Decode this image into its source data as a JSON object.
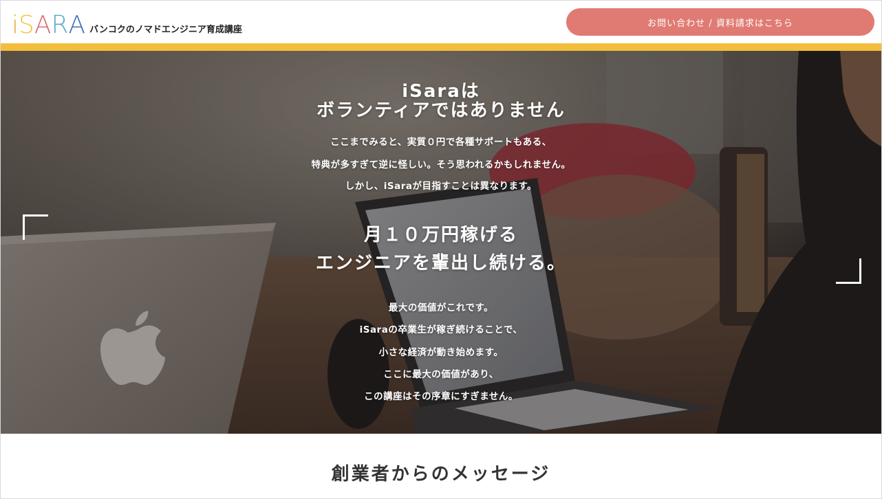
{
  "header": {
    "logo_letters": [
      "i",
      "S",
      "A",
      "R",
      "A"
    ],
    "logo_colors": [
      "#f2a93b",
      "#f3c23e",
      "#e06a6a",
      "#5aa8c8",
      "#3f72b8"
    ],
    "tagline": "バンコクのノマドエンジニア育成講座",
    "contact_button": "お問い合わせ / 資料請求はこちら",
    "contact_color": "#e07b73",
    "accent_color": "#f3bd3c"
  },
  "hero": {
    "title_line1": "iSaraは",
    "title_line2": "ボランティアではありません",
    "intro": [
      "ここまでみると、実質０円で各種サポートもある、",
      "特典が多すぎて逆に怪しい。そう思われるかもしれません。",
      "しかし、iSaraが目指すことは異なります。"
    ],
    "mission_line1": "月１０万円稼げる",
    "mission_line2": "エンジニアを輩出し続ける。",
    "closing": [
      "最大の価値がこれです。",
      "iSaraの卒業生が稼ぎ続けることで、",
      "小さな経済が動き始めます。",
      "ここに最大の価値があり、",
      "この講座はその序章にすぎません。"
    ]
  },
  "message_section": {
    "title": "創業者からのメッセージ"
  }
}
